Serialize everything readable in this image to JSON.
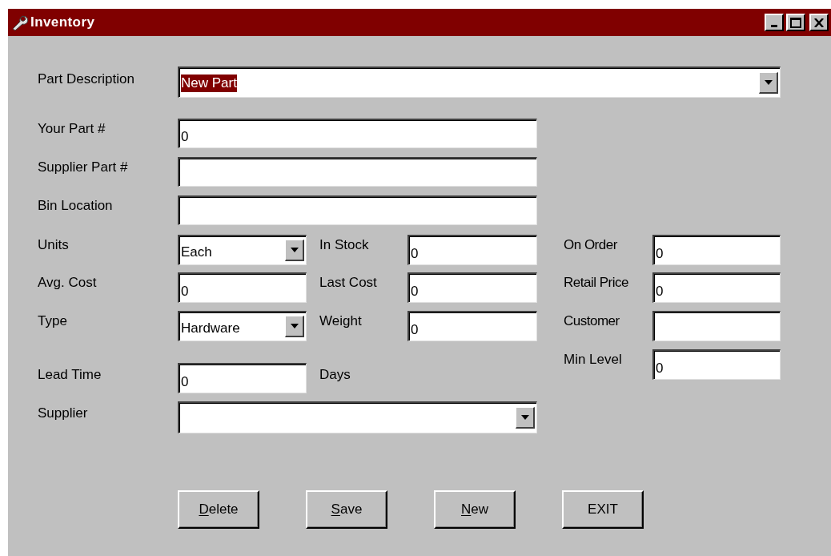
{
  "window": {
    "title": "Inventory"
  },
  "part_description": {
    "label": "Part Description",
    "value": "New Part",
    "highlighted": true
  },
  "fields": [
    {
      "label": "Your Part #",
      "value": "0"
    },
    {
      "label": "Supplier Part #"
    },
    {
      "label": "Bin Location"
    }
  ],
  "grid_rows": [
    [
      {
        "label": "Units",
        "value": "Each",
        "kind": "combo"
      },
      {
        "label": "In Stock",
        "value": "0",
        "kind": "text"
      },
      {
        "label": "On Order",
        "value": "0",
        "kind": "text"
      }
    ],
    [
      {
        "label": "Avg. Cost",
        "value": "0",
        "kind": "text"
      },
      {
        "label": "Last Cost",
        "value": "0",
        "kind": "text"
      },
      {
        "label": "Retail Price",
        "value": "0",
        "kind": "text"
      }
    ],
    [
      {
        "label": "Type",
        "value": "Hardware",
        "kind": "combo"
      },
      {
        "label": "Weight",
        "value": "0",
        "kind": "text"
      },
      {
        "label": "Customer",
        "kind": "text"
      }
    ]
  ],
  "lead_time": {
    "label": "Lead Time",
    "value": "0",
    "unit": "Days"
  },
  "min_level": {
    "label": "Min Level",
    "value": "0"
  },
  "supplier": {
    "label": "Supplier"
  },
  "buttons": [
    {
      "label": "Delete",
      "mnemonic": true
    },
    {
      "label": "Save",
      "mnemonic": true
    },
    {
      "label": "New",
      "mnemonic": true
    },
    {
      "label": "EXIT",
      "mnemonic": false
    }
  ]
}
